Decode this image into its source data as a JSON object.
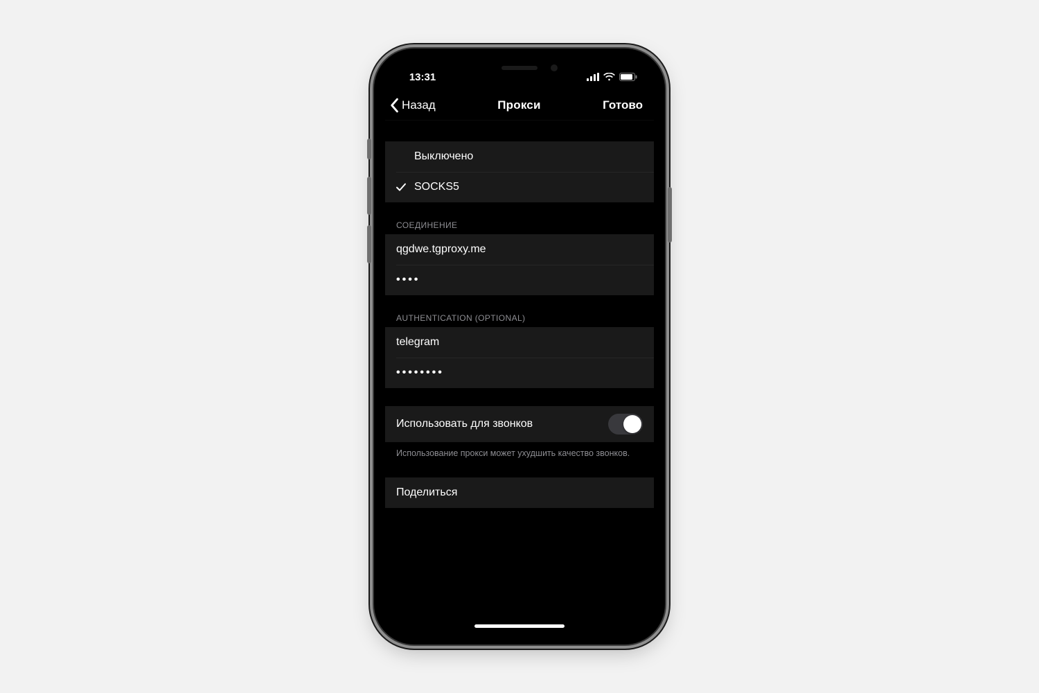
{
  "statusbar": {
    "time": "13:31"
  },
  "nav": {
    "back": "Назад",
    "title": "Прокси",
    "done": "Готово"
  },
  "type_options": {
    "disabled": {
      "label": "Выключено",
      "selected": false
    },
    "socks5": {
      "label": "SOCKS5",
      "selected": true
    }
  },
  "connection": {
    "header": "СОЕДИНЕНИЕ",
    "host": "qgdwe.tgproxy.me",
    "port_masked": "••••"
  },
  "auth": {
    "header": "AUTHENTICATION (OPTIONAL)",
    "username": "telegram",
    "password_masked": "••••••••"
  },
  "calls": {
    "label": "Использовать для звонков",
    "enabled": false,
    "footer": "Использование прокси может ухудшить качество звонков."
  },
  "share": {
    "label": "Поделиться"
  }
}
